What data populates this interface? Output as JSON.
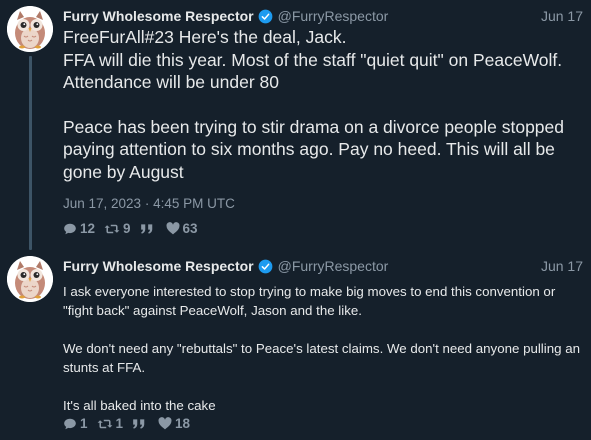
{
  "tweets": [
    {
      "author_name": "Furry Wholesome Respector",
      "handle": "@FurryRespector",
      "date": "Jun 17",
      "lines": [
        "FreeFurAll#23 Here's the deal, Jack.",
        "FFA will die this year. Most of the staff \"quiet quit\" on PeaceWolf.",
        "Attendance will be under 80",
        "Peace has been trying to stir drama on a divorce people stopped paying attention to six months ago. Pay no heed. This will all be gone by August"
      ],
      "timestamp": "Jun 17, 2023 · 4:45 PM UTC",
      "stats": {
        "replies": "12",
        "retweets": "9",
        "quotes": "",
        "likes": "63"
      }
    },
    {
      "author_name": "Furry Wholesome Respector",
      "handle": "@FurryRespector",
      "date": "Jun 17",
      "paragraphs": [
        "I ask everyone interested to stop trying to make big moves to end this convention or \"fight back\" against PeaceWolf, Jason and the like.",
        "We don't need any \"rebuttals\" to Peace's latest claims. We don't need anyone pulling an stunts at FFA.",
        "It's all baked into the cake"
      ],
      "stats": {
        "replies": "1",
        "retweets": "1",
        "quotes": "",
        "likes": "18"
      }
    }
  ],
  "colors": {
    "background": "#15202b",
    "text": "#e7e9ea",
    "muted": "#8b98a5",
    "verified": "#1d9bf0",
    "thread_line": "#3d5466"
  },
  "icons": {
    "avatar": "owl-avatar",
    "verified": "verified-badge-icon",
    "reply": "speech-bubble-icon",
    "retweet": "retweet-icon",
    "quote": "quote-icon",
    "like": "heart-icon"
  }
}
